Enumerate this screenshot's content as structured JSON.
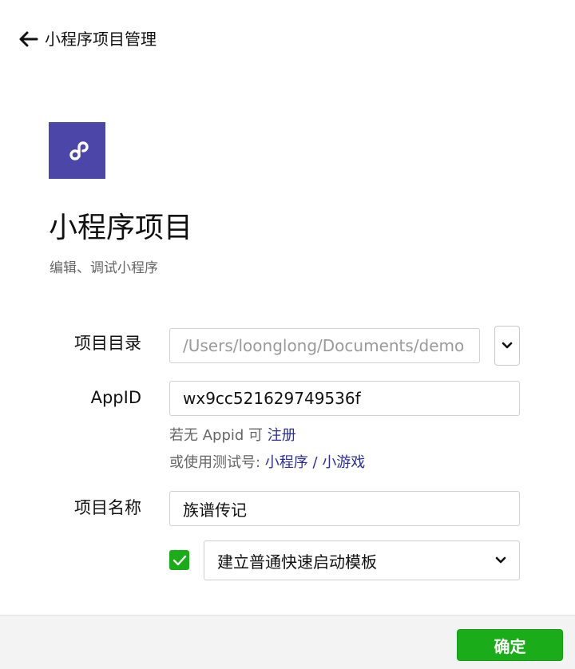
{
  "header": {
    "back_label": "小程序项目管理"
  },
  "project": {
    "title": "小程序项目",
    "subtitle": "编辑、调试小程序",
    "logo_icon": "mini-program-link-icon",
    "logo_color": "#4b46a8"
  },
  "form": {
    "dir_label": "项目目录",
    "dir_value": "/Users/loonglong/Documents/demo",
    "appid_label": "AppID",
    "appid_value": "wx9cc521629749536f",
    "hint_no_appid_prefix": "若无 Appid 可 ",
    "hint_register_link": "注册",
    "hint_test_prefix": "或使用测试号: ",
    "hint_mini_program_link": "小程序",
    "hint_separator": " / ",
    "hint_mini_game_link": "小游戏",
    "name_label": "项目名称",
    "name_value": "族谱传记",
    "quickstart_checked": true,
    "template_selected": "建立普通快速启动模板"
  },
  "footer": {
    "confirm_label": "确定"
  },
  "colors": {
    "accent_green": "#1aad19",
    "link_blue": "#2d2d9c"
  }
}
